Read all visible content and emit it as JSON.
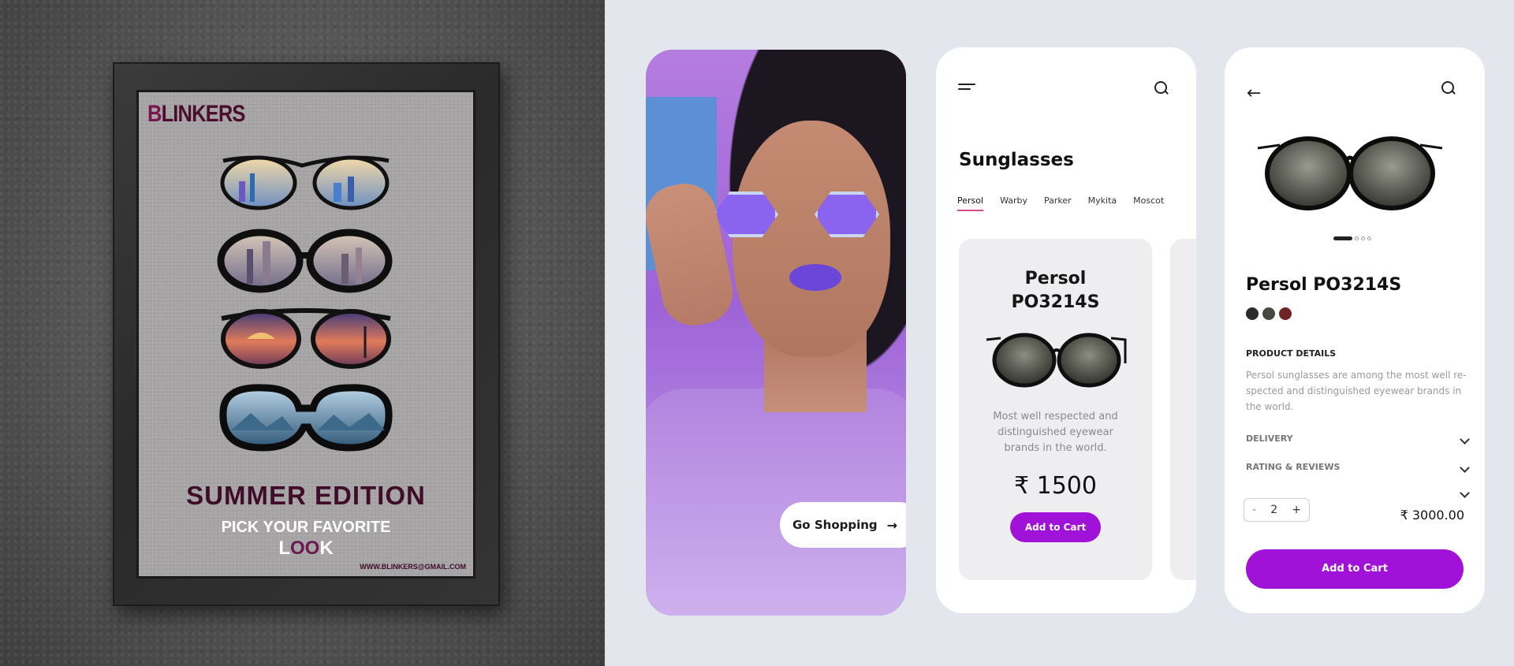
{
  "poster": {
    "brand": "BLINKERS",
    "headline": "SUMMER EDITION",
    "subline": "PICK YOUR FAVORITE",
    "look": "LOOK",
    "email": "WWW.BLINKERS@GMAIL.COM"
  },
  "hero": {
    "cta_label": "Go Shopping"
  },
  "listing": {
    "title": "Sunglasses",
    "tabs": [
      "Persol",
      "Warby",
      "Parker",
      "Mykita",
      "Moscot"
    ],
    "active_tab": "Persol",
    "card": {
      "name": "Persol PO3214S",
      "description": "Most well respected and distinguished eyewear brands in the world.",
      "price": "₹ 1500",
      "button": "Add to Cart"
    }
  },
  "detail": {
    "title": "Persol PO3214S",
    "colors": [
      "#2b2b2b",
      "#454a3e",
      "#6e2326"
    ],
    "product_details_label": "PRODUCT DETAILS",
    "product_details_text": "Persol sunglasses are among the most well re-spected and distinguished eyewear brands in the world.",
    "delivery_label": "DELIVERY",
    "rating_label": "RATING & REVIEWS",
    "quantity": "2",
    "minus": "-",
    "plus": "+",
    "total": "₹ 3000.00",
    "button": "Add to Cart"
  },
  "colors": {
    "accent": "#a012d8",
    "tab_underline": "#e04a8c",
    "background": "#e3e6ec"
  }
}
